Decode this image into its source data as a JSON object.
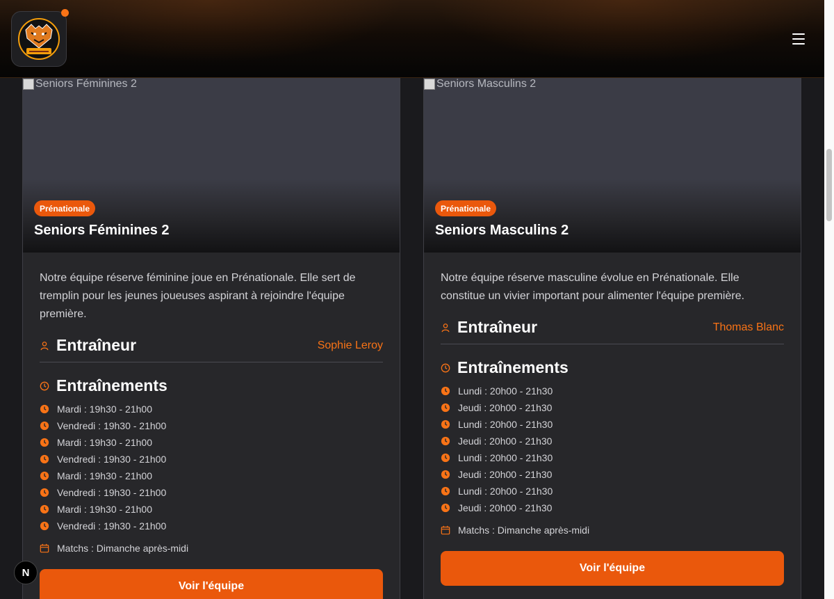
{
  "header": {
    "logo_alt": "Handball club logo",
    "menu_icon": "hamburger-menu-icon"
  },
  "teams": [
    {
      "image_alt": "Seniors Féminines 2",
      "badge": "Prénationale",
      "title": "Seniors Féminines 2",
      "description": "Notre équipe réserve féminine joue en Prénationale. Elle sert de tremplin pour les jeunes joueuses aspirant à rejoindre l'équipe première.",
      "coach_heading": "Entraîneur",
      "coach_name": "Sophie Leroy",
      "trainings_heading": "Entraînements",
      "trainings": [
        "Mardi : 19h30 - 21h00",
        "Vendredi : 19h30 - 21h00",
        "Mardi : 19h30 - 21h00",
        "Vendredi : 19h30 - 21h00",
        "Mardi : 19h30 - 21h00",
        "Vendredi : 19h30 - 21h00",
        "Mardi : 19h30 - 21h00",
        "Vendredi : 19h30 - 21h00"
      ],
      "matches": "Matchs : Dimanche après-midi",
      "cta": "Voir l'équipe"
    },
    {
      "image_alt": "Seniors Masculins 2",
      "badge": "Prénationale",
      "title": "Seniors Masculins 2",
      "description": "Notre équipe réserve masculine évolue en Prénationale. Elle constitue un vivier important pour alimenter l'équipe première.",
      "coach_heading": "Entraîneur",
      "coach_name": "Thomas Blanc",
      "trainings_heading": "Entraînements",
      "trainings": [
        "Lundi : 20h00 - 21h30",
        "Jeudi : 20h00 - 21h30",
        "Lundi : 20h00 - 21h30",
        "Jeudi : 20h00 - 21h30",
        "Lundi : 20h00 - 21h30",
        "Jeudi : 20h00 - 21h30",
        "Lundi : 20h00 - 21h30",
        "Jeudi : 20h00 - 21h30"
      ],
      "matches": "Matchs : Dimanche après-midi",
      "cta": "Voir l'équipe"
    }
  ],
  "dev_badge": "N",
  "colors": {
    "accent": "#ea580c",
    "accent_text": "#f97316",
    "card_bg": "#27272a",
    "page_bg": "#1a1a1d"
  }
}
